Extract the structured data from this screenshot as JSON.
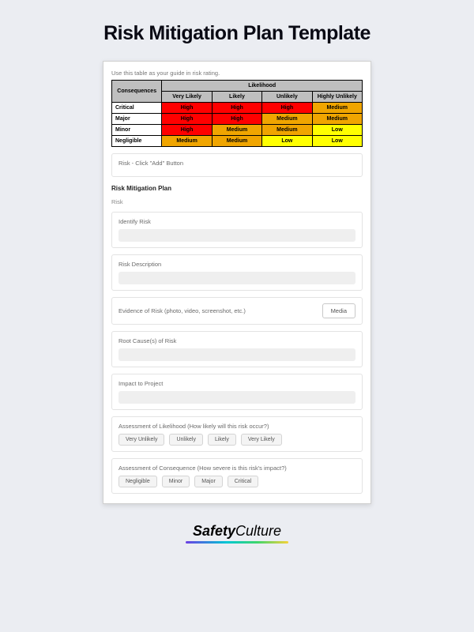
{
  "title": "Risk Mitigation Plan Template",
  "guide_note": "Use this table as your guide in risk rating.",
  "matrix": {
    "col_group": "Likelihood",
    "row_header": "Consequences",
    "cols": [
      "Very Likely",
      "Likely",
      "Unlikely",
      "Highly Unlikely"
    ],
    "rows": [
      {
        "label": "Critical",
        "cells": [
          "High",
          "High",
          "High",
          "Medium"
        ]
      },
      {
        "label": "Major",
        "cells": [
          "High",
          "High",
          "Medium",
          "Medium"
        ]
      },
      {
        "label": "Minor",
        "cells": [
          "High",
          "Medium",
          "Medium",
          "Low"
        ]
      },
      {
        "label": "Negligible",
        "cells": [
          "Medium",
          "Medium",
          "Low",
          "Low"
        ]
      }
    ]
  },
  "risk_add_note": "Risk - Click \"Add\" Button",
  "plan_heading": "Risk Mitigation Plan",
  "risk_sub": "Risk",
  "fields": {
    "identify": "Identify Risk",
    "description": "Risk Description",
    "evidence": "Evidence of Risk (photo, video, screenshot, etc.)",
    "media_btn": "Media",
    "root_cause": "Root Cause(s) of Risk",
    "impact": "Impact to Project"
  },
  "likelihood_q": "Assessment of Likelihood (How likely will this risk occur?)",
  "likelihood_opts": [
    "Very Unlikely",
    "Unlikely",
    "Likely",
    "Very Likely"
  ],
  "consequence_q": "Assessment of Consequence (How severe is this risk's impact?)",
  "consequence_opts": [
    "Negligible",
    "Minor",
    "Major",
    "Critical"
  ],
  "brand": {
    "a": "Safety",
    "b": "Culture"
  },
  "colors": {
    "high": "#ff0000",
    "medium": "#f0a500",
    "low": "#ffff00"
  }
}
